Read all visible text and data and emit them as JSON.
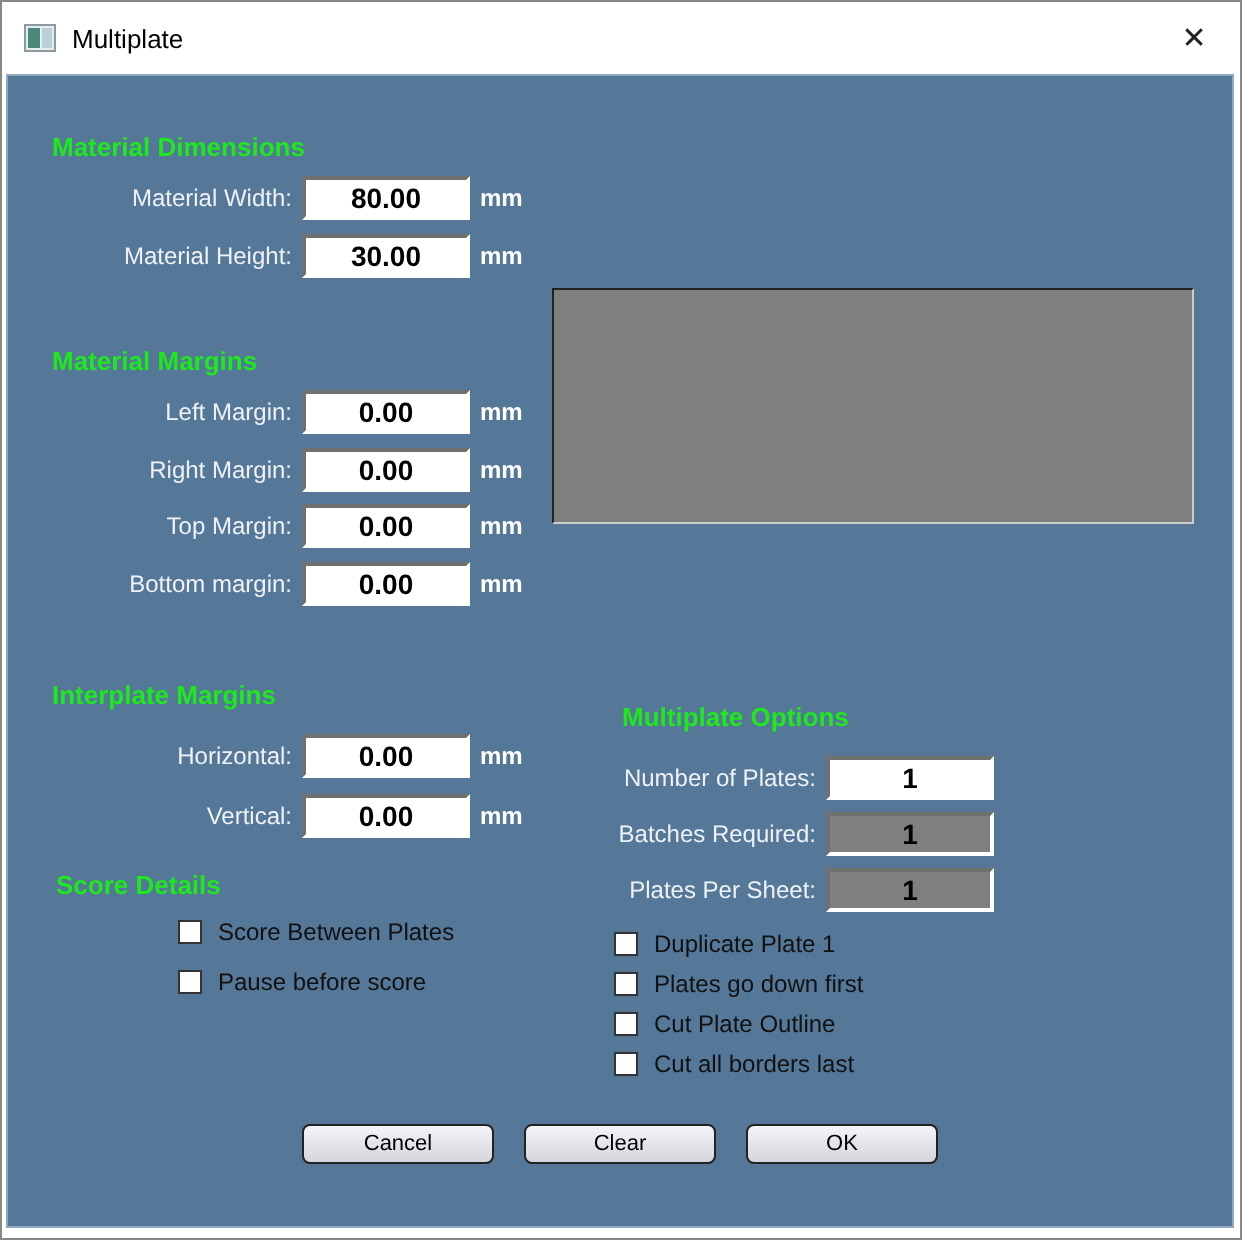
{
  "window": {
    "title": "Multiplate",
    "close": "✕"
  },
  "left_sections": [
    {
      "heading": "Material Dimensions",
      "fields": [
        {
          "label": "Material Width:",
          "value": "80.00",
          "unit": "mm"
        },
        {
          "label": "Material Height:",
          "value": "30.00",
          "unit": "mm"
        }
      ]
    },
    {
      "heading": "Material Margins",
      "fields": [
        {
          "label": "Left Margin:",
          "value": "0.00",
          "unit": "mm"
        },
        {
          "label": "Right Margin:",
          "value": "0.00",
          "unit": "mm"
        },
        {
          "label": "Top Margin:",
          "value": "0.00",
          "unit": "mm"
        },
        {
          "label": "Bottom margin:",
          "value": "0.00",
          "unit": "mm"
        }
      ]
    },
    {
      "heading": "Interplate Margins",
      "fields": [
        {
          "label": "Horizontal:",
          "value": "0.00",
          "unit": "mm"
        },
        {
          "label": "Vertical:",
          "value": "0.00",
          "unit": "mm"
        }
      ]
    }
  ],
  "score_details": {
    "heading": "Score Details",
    "options": [
      {
        "label": "Score Between Plates",
        "checked": false
      },
      {
        "label": "Pause before score",
        "checked": false
      }
    ]
  },
  "multiplate_options": {
    "heading": "Multiplate Options",
    "fields": [
      {
        "label": "Number of Plates:",
        "value": "1",
        "disabled": false
      },
      {
        "label": "Batches Required:",
        "value": "1",
        "disabled": true
      },
      {
        "label": "Plates Per Sheet:",
        "value": "1",
        "disabled": true
      }
    ],
    "options": [
      {
        "label": "Duplicate Plate 1",
        "checked": false
      },
      {
        "label": "Plates go down first",
        "checked": false
      },
      {
        "label": "Cut Plate Outline",
        "checked": false
      },
      {
        "label": "Cut all borders last",
        "checked": false
      }
    ]
  },
  "buttons": [
    "Cancel",
    "Clear",
    "OK"
  ]
}
